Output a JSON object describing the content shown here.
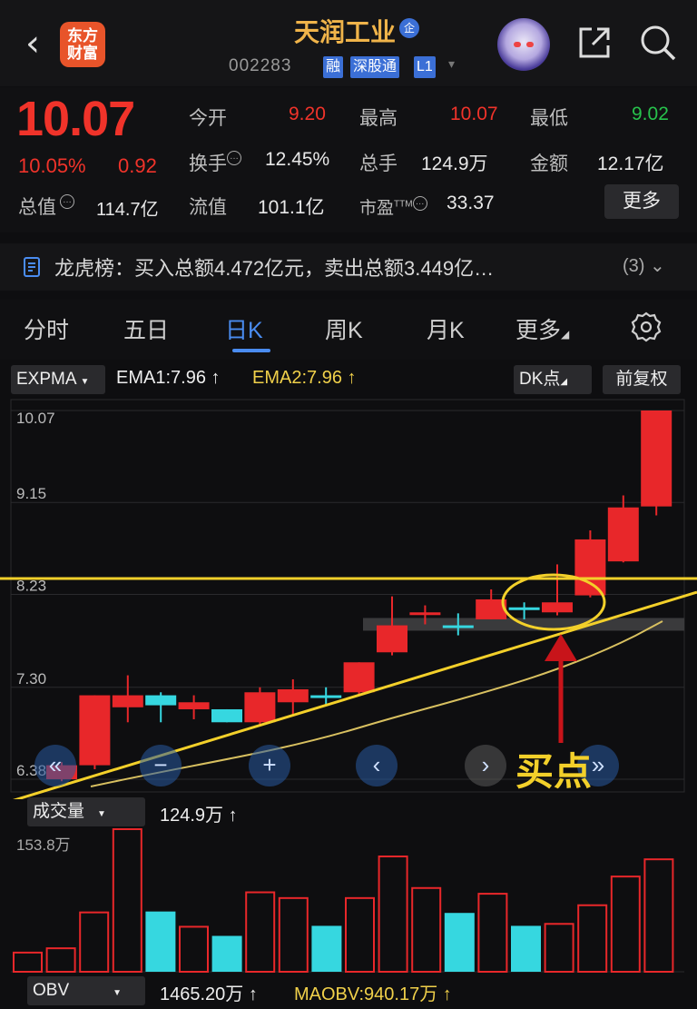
{
  "header": {
    "back_icon": "chevron-left-icon",
    "logo_text_1": "东方",
    "logo_text_2": "财富",
    "stock_name": "天润工业",
    "badge": "企",
    "stock_code": "002283",
    "tags": [
      "融",
      "深股通",
      "L1"
    ],
    "share_icon": "share-icon",
    "search_icon": "search-icon"
  },
  "quote": {
    "price": "10.07",
    "change_pct": "10.05%",
    "change": "0.92",
    "open_label": "今开",
    "open": "9.20",
    "high_label": "最高",
    "high": "10.07",
    "low_label": "最低",
    "low": "9.02",
    "turnover_label": "换手",
    "turnover": "12.45%",
    "volume_label": "总手",
    "volume": "124.9万",
    "amount_label": "金额",
    "amount": "12.17亿",
    "mktcap_label": "总值",
    "mktcap": "114.7亿",
    "float_label": "流值",
    "float_cap": "101.1亿",
    "pe_label": "市盈",
    "pe_sup": "TTM",
    "pe": "33.37",
    "more_label": "更多"
  },
  "dragon": {
    "text": "龙虎榜：买入总额4.472亿元，卖出总额3.449亿…",
    "count": "(3)"
  },
  "tabs": [
    "分时",
    "五日",
    "日K",
    "周K",
    "月K",
    "更多"
  ],
  "active_tab": "日K",
  "indicator": {
    "name": "EXPMA",
    "ema1": "EMA1:7.96",
    "ema2": "EMA2:7.96",
    "dk_label": "DK点",
    "adjust_label": "前复权"
  },
  "chart_data": {
    "type": "candlestick",
    "y_ticks": [
      "10.07",
      "9.15",
      "8.23",
      "7.30",
      "6.38"
    ],
    "ylim": [
      6.38,
      10.07
    ],
    "candles": [
      {
        "o": 6.38,
        "c": 6.52,
        "h": 6.55,
        "l": 6.36,
        "dir": "up"
      },
      {
        "o": 6.52,
        "c": 7.22,
        "h": 7.22,
        "l": 6.48,
        "dir": "up"
      },
      {
        "o": 7.1,
        "c": 7.22,
        "h": 7.42,
        "l": 6.95,
        "dir": "up"
      },
      {
        "o": 7.12,
        "c": 7.22,
        "h": 7.25,
        "l": 6.95,
        "dir": "down"
      },
      {
        "o": 7.15,
        "c": 7.08,
        "h": 7.22,
        "l": 6.98,
        "dir": "up"
      },
      {
        "o": 7.08,
        "c": 6.95,
        "h": 7.08,
        "l": 6.95,
        "dir": "down"
      },
      {
        "o": 6.95,
        "c": 7.25,
        "h": 7.3,
        "l": 6.92,
        "dir": "up"
      },
      {
        "o": 7.15,
        "c": 7.28,
        "h": 7.38,
        "l": 7.02,
        "dir": "up"
      },
      {
        "o": 7.22,
        "c": 7.22,
        "h": 7.3,
        "l": 7.12,
        "dir": "down"
      },
      {
        "o": 7.25,
        "c": 7.55,
        "h": 7.55,
        "l": 7.22,
        "dir": "up"
      },
      {
        "o": 7.65,
        "c": 7.92,
        "h": 8.21,
        "l": 7.62,
        "dir": "up"
      },
      {
        "o": 8.05,
        "c": 8.05,
        "h": 8.12,
        "l": 7.93,
        "dir": "up"
      },
      {
        "o": 7.92,
        "c": 7.92,
        "h": 8.04,
        "l": 7.82,
        "dir": "down"
      },
      {
        "o": 7.98,
        "c": 8.18,
        "h": 8.28,
        "l": 7.98,
        "dir": "up"
      },
      {
        "o": 8.1,
        "c": 8.1,
        "h": 8.15,
        "l": 7.98,
        "dir": "down"
      },
      {
        "o": 8.05,
        "c": 8.15,
        "h": 8.53,
        "l": 8.02,
        "dir": "up"
      },
      {
        "o": 8.22,
        "c": 8.78,
        "h": 8.87,
        "l": 8.2,
        "dir": "up"
      },
      {
        "o": 8.56,
        "c": 9.1,
        "h": 9.22,
        "l": 8.55,
        "dir": "up"
      },
      {
        "o": 9.11,
        "c": 10.07,
        "h": 10.07,
        "l": 9.02,
        "dir": "up"
      }
    ],
    "volume": {
      "label": "成交量",
      "value": "124.9万",
      "max_label": "153.8万",
      "values": [
        0.14,
        0.17,
        0.42,
        1.0,
        0.42,
        0.32,
        0.25,
        0.56,
        0.52,
        0.32,
        0.52,
        0.81,
        0.59,
        0.41,
        0.55,
        0.32,
        0.34,
        0.47,
        0.67,
        0.79
      ],
      "dir": [
        "up",
        "up",
        "up",
        "up",
        "down",
        "up",
        "down",
        "up",
        "up",
        "down",
        "up",
        "up",
        "up",
        "down",
        "up",
        "down",
        "up",
        "up",
        "up",
        "up"
      ]
    },
    "obv": {
      "label": "OBV",
      "value": "1465.20万",
      "maobv": "MAOBV:940.17万"
    },
    "annotation": "买点"
  }
}
